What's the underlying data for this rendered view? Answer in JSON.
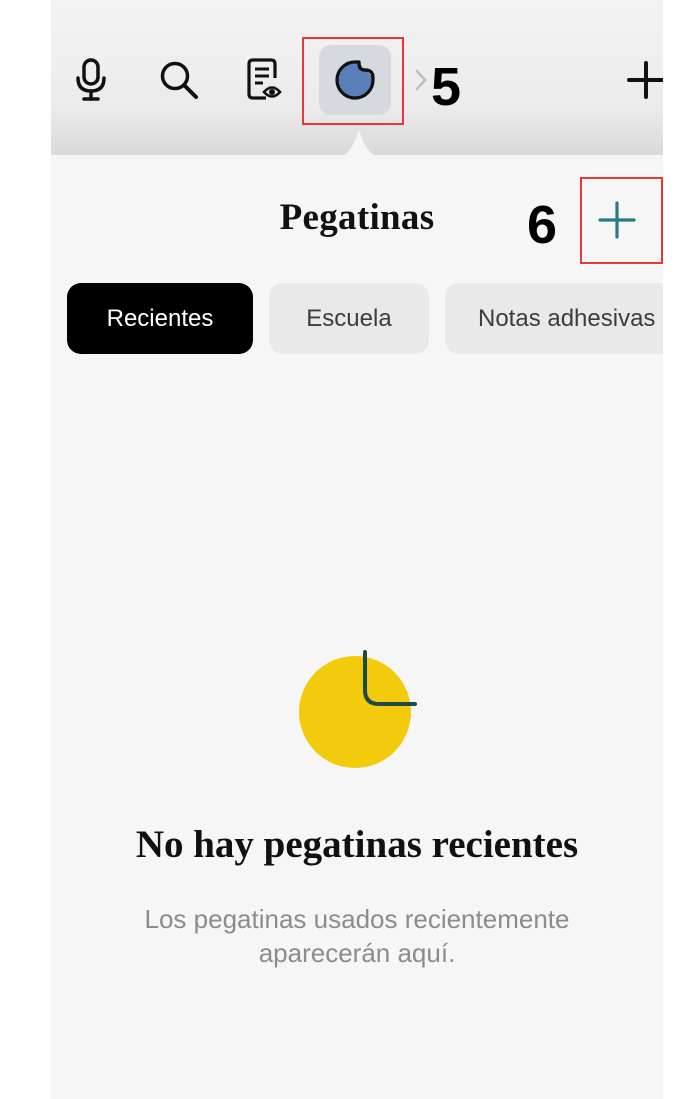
{
  "toolbar": {
    "icons": [
      "microphone-icon",
      "search-icon",
      "reader-view-icon",
      "sticker-icon",
      "chevron-right-icon",
      "plus-icon"
    ],
    "step_label": "5"
  },
  "sheet": {
    "title": "Pegatinas",
    "add_icon": "plus-icon",
    "step_label": "6",
    "tabs": [
      {
        "label": "Recientes",
        "active": true
      },
      {
        "label": "Escuela",
        "active": false
      },
      {
        "label": "Notas adhesivas",
        "active": false
      }
    ]
  },
  "empty_state": {
    "title": "No hay pegatinas recientes",
    "description": "Los pegatinas usados recientemente aparecerán aquí."
  },
  "colors": {
    "accent": "#2a7a86",
    "highlight": "#e53935",
    "sticker_yellow": "#f2cc0c",
    "sticker_curve": "#1f4a4a",
    "sticker_icon_fill": "#5b7fb8",
    "active_tab_bg": "#000000",
    "tab_bg": "#e9e9e9"
  }
}
